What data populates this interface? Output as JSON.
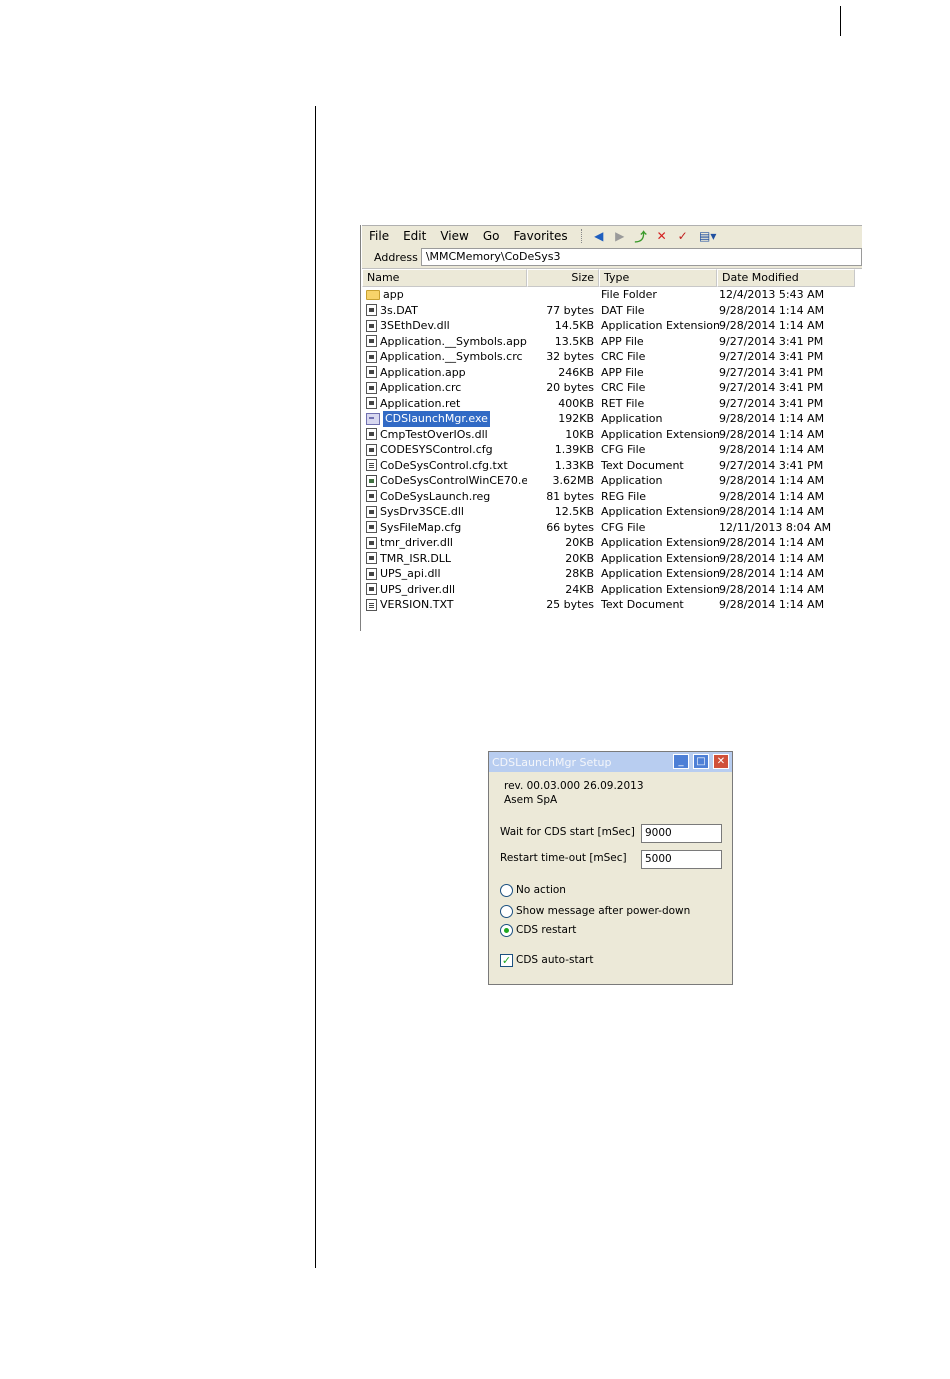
{
  "explorer": {
    "menu": [
      "File",
      "Edit",
      "View",
      "Go",
      "Favorites"
    ],
    "toolbar_icons": [
      "back-icon",
      "forward-icon",
      "up-folder-icon",
      "delete-icon",
      "properties-icon",
      "views-icon"
    ],
    "address_label": "Address",
    "address_value": "\\MMCMemory\\CoDeSys3",
    "columns": {
      "name": "Name",
      "size": "Size",
      "type": "Type",
      "date": "Date Modified"
    },
    "files": [
      {
        "name": "app",
        "size": "",
        "type": "File Folder",
        "date": "12/4/2013 5:43 AM",
        "icon": "folder"
      },
      {
        "name": "3s.DAT",
        "size": "77 bytes",
        "type": "DAT File",
        "date": "9/28/2014 1:14 AM",
        "icon": "file"
      },
      {
        "name": "3SEthDev.dll",
        "size": "14.5KB",
        "type": "Application Extension",
        "date": "9/28/2014 1:14 AM",
        "icon": "dll"
      },
      {
        "name": "Application.__Symbols.app",
        "size": "13.5KB",
        "type": "APP File",
        "date": "9/27/2014 3:41 PM",
        "icon": "file"
      },
      {
        "name": "Application.__Symbols.crc",
        "size": "32 bytes",
        "type": "CRC File",
        "date": "9/27/2014 3:41 PM",
        "icon": "file"
      },
      {
        "name": "Application.app",
        "size": "246KB",
        "type": "APP File",
        "date": "9/27/2014 3:41 PM",
        "icon": "file"
      },
      {
        "name": "Application.crc",
        "size": "20 bytes",
        "type": "CRC File",
        "date": "9/27/2014 3:41 PM",
        "icon": "file"
      },
      {
        "name": "Application.ret",
        "size": "400KB",
        "type": "RET File",
        "date": "9/27/2014 3:41 PM",
        "icon": "file"
      },
      {
        "name": "CDSlaunchMgr.exe",
        "size": "192KB",
        "type": "Application",
        "date": "9/28/2014 1:14 AM",
        "icon": "exe",
        "selected": true
      },
      {
        "name": "CmpTestOverIOs.dll",
        "size": "10KB",
        "type": "Application Extension",
        "date": "9/28/2014 1:14 AM",
        "icon": "dll"
      },
      {
        "name": "CODESYSControl.cfg",
        "size": "1.39KB",
        "type": "CFG File",
        "date": "9/28/2014 1:14 AM",
        "icon": "file"
      },
      {
        "name": "CoDeSysControl.cfg.txt",
        "size": "1.33KB",
        "type": "Text Document",
        "date": "9/27/2014 3:41 PM",
        "icon": "txt"
      },
      {
        "name": "CoDeSysControlWinCE70.e...",
        "size": "3.62MB",
        "type": "Application",
        "date": "9/28/2014 1:14 AM",
        "icon": "app"
      },
      {
        "name": "CoDeSysLaunch.reg",
        "size": "81 bytes",
        "type": "REG File",
        "date": "9/28/2014 1:14 AM",
        "icon": "file"
      },
      {
        "name": "SysDrv3SCE.dll",
        "size": "12.5KB",
        "type": "Application Extension",
        "date": "9/28/2014 1:14 AM",
        "icon": "dll"
      },
      {
        "name": "SysFileMap.cfg",
        "size": "66 bytes",
        "type": "CFG File",
        "date": "12/11/2013 8:04 AM",
        "icon": "file"
      },
      {
        "name": "tmr_driver.dll",
        "size": "20KB",
        "type": "Application Extension",
        "date": "9/28/2014 1:14 AM",
        "icon": "dll"
      },
      {
        "name": "TMR_ISR.DLL",
        "size": "20KB",
        "type": "Application Extension",
        "date": "9/28/2014 1:14 AM",
        "icon": "dll"
      },
      {
        "name": "UPS_api.dll",
        "size": "28KB",
        "type": "Application Extension",
        "date": "9/28/2014 1:14 AM",
        "icon": "dll"
      },
      {
        "name": "UPS_driver.dll",
        "size": "24KB",
        "type": "Application Extension",
        "date": "9/28/2014 1:14 AM",
        "icon": "dll"
      },
      {
        "name": "VERSION.TXT",
        "size": "25 bytes",
        "type": "Text Document",
        "date": "9/28/2014 1:14 AM",
        "icon": "txt"
      }
    ]
  },
  "dialog": {
    "title": "CDSLaunchMgr Setup",
    "rev": "rev. 00.03.000 26.09.2013",
    "company": "Asem SpA",
    "wait_label": "Wait for CDS start [mSec]",
    "wait_value": "9000",
    "restart_label": "Restart time-out [mSec]",
    "restart_value": "5000",
    "radios": [
      {
        "label": "No action",
        "selected": false
      },
      {
        "label": "Show message after power-down",
        "selected": false
      },
      {
        "label": "CDS restart",
        "selected": true
      }
    ],
    "autostart_label": "CDS auto-start",
    "autostart_checked": true
  }
}
